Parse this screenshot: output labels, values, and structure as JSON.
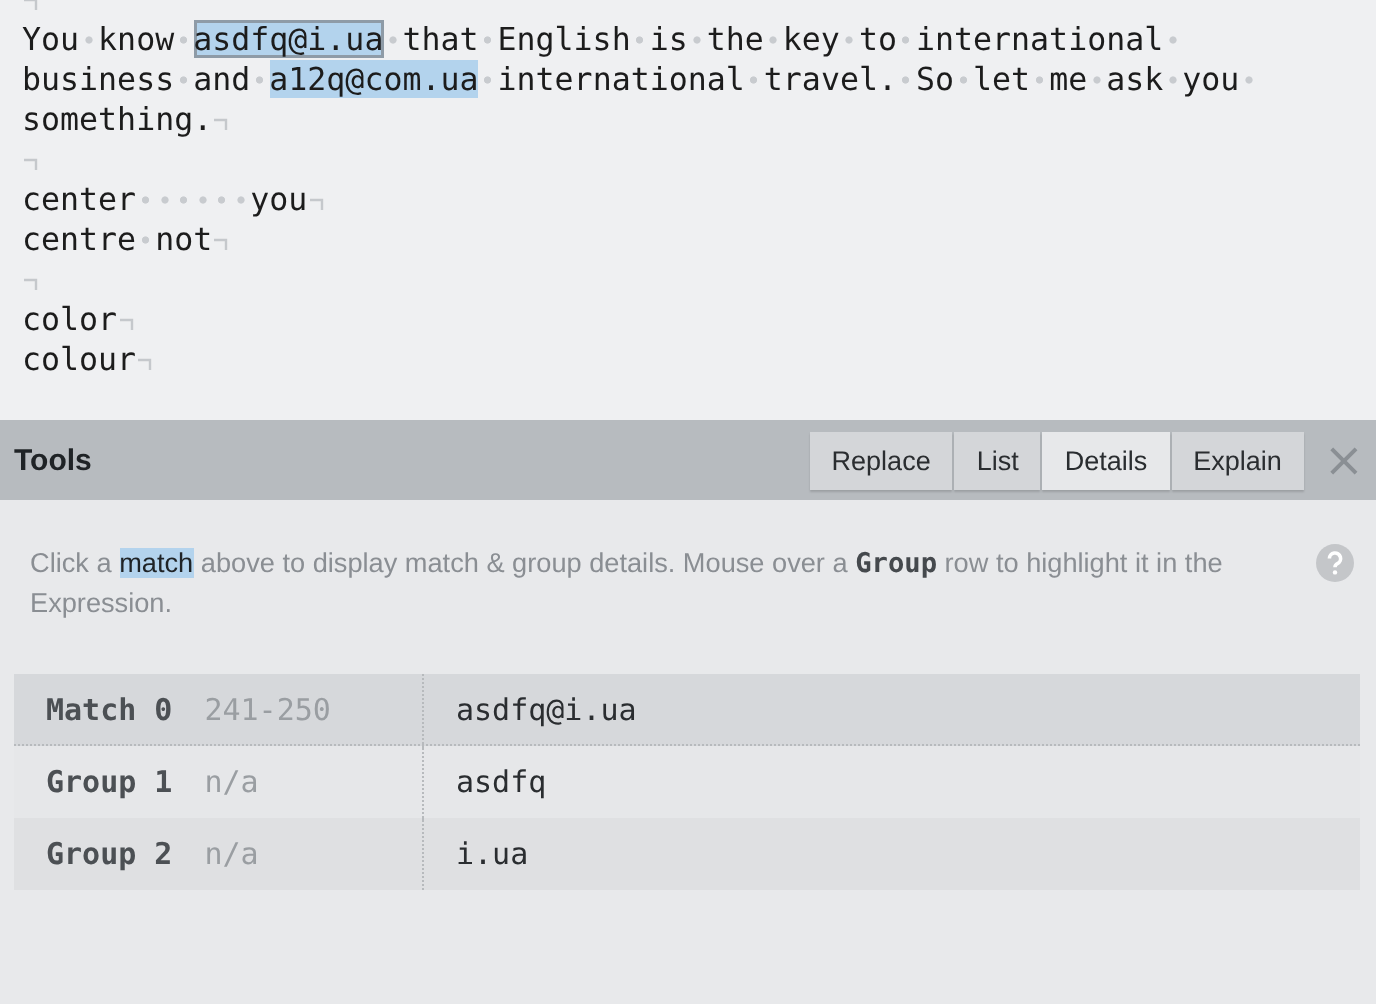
{
  "editor": {
    "lines": [
      {
        "eol": true
      },
      {
        "eol": false,
        "segments": [
          {
            "text": "You know ",
            "kind": "text"
          },
          {
            "text": "asdfq@i.ua",
            "kind": "current-match"
          },
          {
            "text": " that English is the key to international ",
            "kind": "text"
          }
        ]
      },
      {
        "eol": false,
        "segments": [
          {
            "text": "business and ",
            "kind": "text"
          },
          {
            "text": "a12q@com.ua",
            "kind": "match"
          },
          {
            "text": " international travel. So let me ask you ",
            "kind": "text"
          }
        ]
      },
      {
        "eol": true,
        "segments": [
          {
            "text": "something.",
            "kind": "text"
          }
        ]
      },
      {
        "eol": true
      },
      {
        "eol": true,
        "segments": [
          {
            "text": "center      you",
            "kind": "text"
          }
        ]
      },
      {
        "eol": true,
        "segments": [
          {
            "text": "centre not",
            "kind": "text"
          }
        ]
      },
      {
        "eol": true
      },
      {
        "eol": true,
        "segments": [
          {
            "text": "color",
            "kind": "text"
          }
        ]
      },
      {
        "eol": true,
        "segments": [
          {
            "text": "colour",
            "kind": "text"
          }
        ]
      }
    ]
  },
  "tools": {
    "title": "Tools",
    "tabs": [
      {
        "label": "Replace",
        "selected": false
      },
      {
        "label": "List",
        "selected": false
      },
      {
        "label": "Details",
        "selected": true
      },
      {
        "label": "Explain",
        "selected": false
      }
    ],
    "close": "×",
    "description": [
      {
        "text": "Click a ",
        "kind": "text"
      },
      {
        "text": "match",
        "kind": "match"
      },
      {
        "text": " above to display match & group details. Mouse over a **Group** row to highlight it in the Expression.",
        "kind": "text"
      }
    ],
    "rows": [
      {
        "label": "Match 0",
        "range": "241-250",
        "value": "asdfq@i.ua",
        "selected": true
      },
      {
        "label": "Group 1",
        "range": "n/a",
        "value": "asdfq",
        "selected": false
      },
      {
        "label": "Group 2",
        "range": "n/a",
        "value": "i.ua",
        "selected": false
      }
    ]
  }
}
